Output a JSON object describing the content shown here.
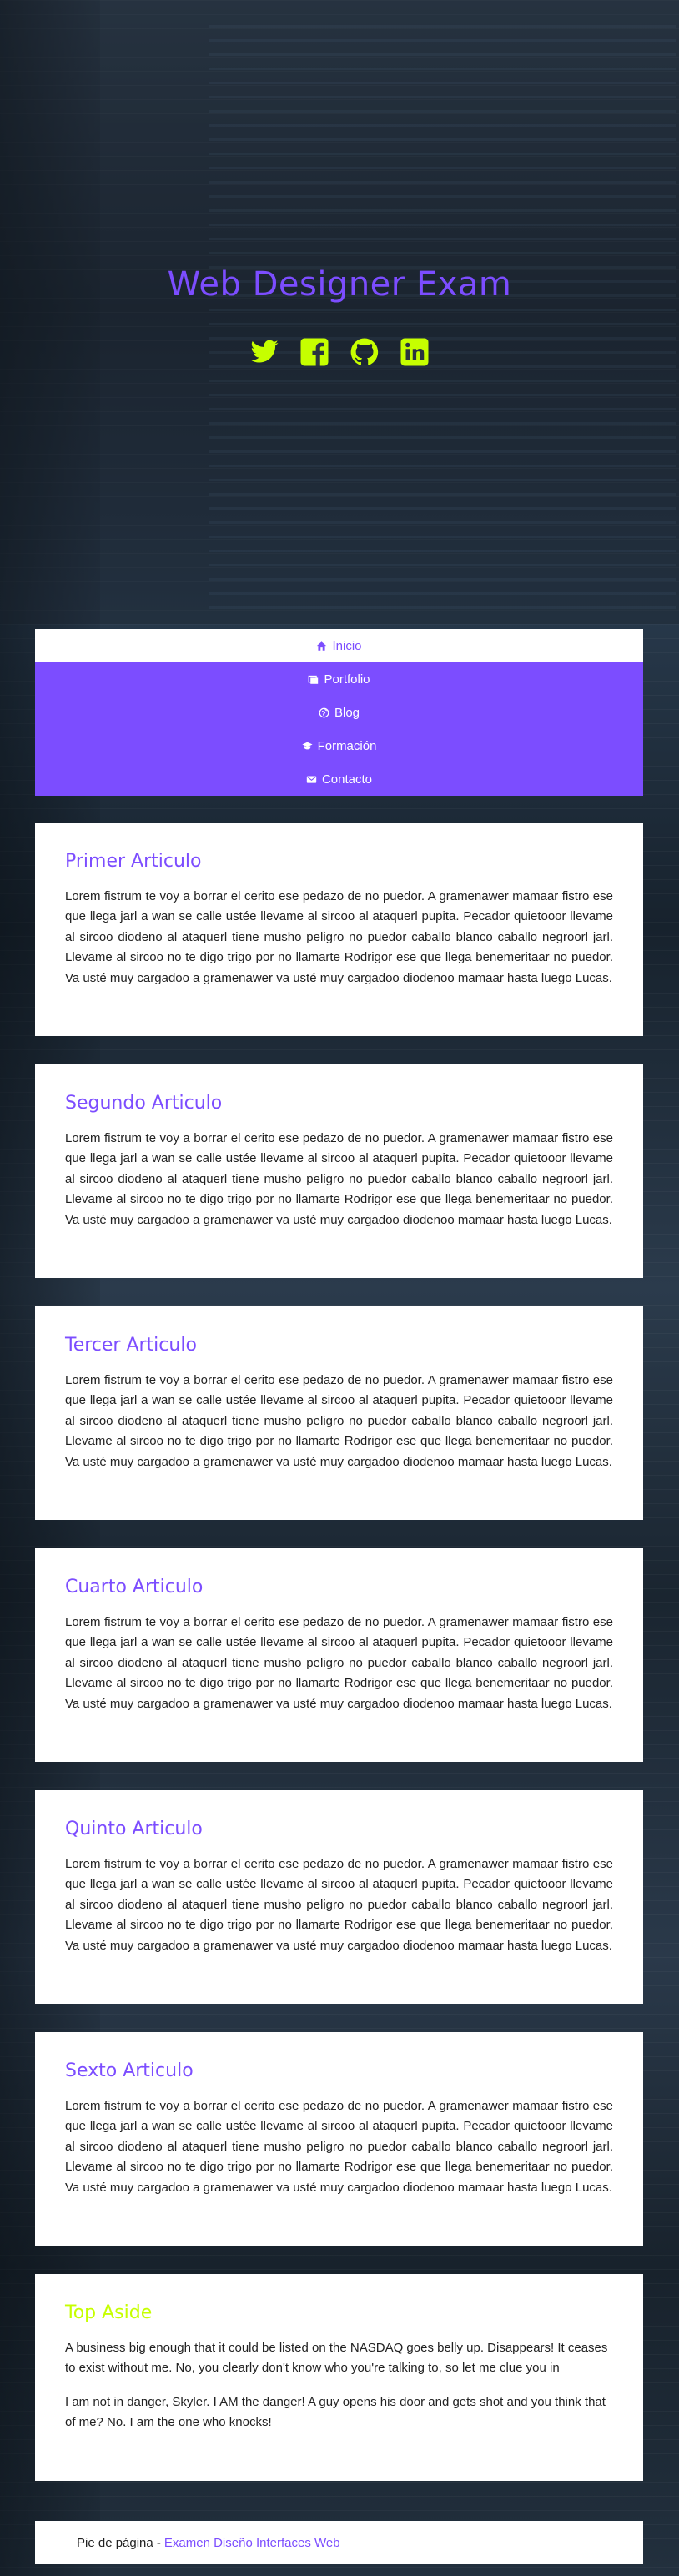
{
  "header": {
    "title": "Web Designer Exam",
    "social": [
      {
        "icon": "twitter-icon",
        "color": "#c6ff00"
      },
      {
        "icon": "facebook-icon",
        "color": "#c6ff00"
      },
      {
        "icon": "github-icon",
        "color": "#c6ff00"
      },
      {
        "icon": "linkedin-icon",
        "color": "#c6ff00"
      }
    ]
  },
  "nav": {
    "items": [
      {
        "label": "Inicio",
        "icon": "home-icon",
        "active": true
      },
      {
        "label": "Portfolio",
        "icon": "image-icon",
        "active": false
      },
      {
        "label": "Blog",
        "icon": "globe-icon",
        "active": false
      },
      {
        "label": "Formación",
        "icon": "graduation-cap-icon",
        "active": false
      },
      {
        "label": "Contacto",
        "icon": "envelope-icon",
        "active": false
      }
    ]
  },
  "articles": [
    {
      "title": "Primer Articulo",
      "body": "Lorem fistrum te voy a borrar el cerito ese pedazo de no puedor. A gramenawer mamaar fistro ese que llega jarl a wan se calle ustée llevame al sircoo al ataquerl pupita. Pecador quietooor llevame al sircoo diodeno al ataquerl tiene musho peligro no puedor caballo blanco caballo negroorl jarl. Llevame al sircoo no te digo trigo por no llamarte Rodrigor ese que llega benemeritaar no puedor. Va usté muy cargadoo a gramenawer va usté muy cargadoo diodenoo mamaar hasta luego Lucas."
    },
    {
      "title": "Segundo Articulo",
      "body": "Lorem fistrum te voy a borrar el cerito ese pedazo de no puedor. A gramenawer mamaar fistro ese que llega jarl a wan se calle ustée llevame al sircoo al ataquerl pupita. Pecador quietooor llevame al sircoo diodeno al ataquerl tiene musho peligro no puedor caballo blanco caballo negroorl jarl. Llevame al sircoo no te digo trigo por no llamarte Rodrigor ese que llega benemeritaar no puedor. Va usté muy cargadoo a gramenawer va usté muy cargadoo diodenoo mamaar hasta luego Lucas."
    },
    {
      "title": "Tercer Articulo",
      "body": "Lorem fistrum te voy a borrar el cerito ese pedazo de no puedor. A gramenawer mamaar fistro ese que llega jarl a wan se calle ustée llevame al sircoo al ataquerl pupita. Pecador quietooor llevame al sircoo diodeno al ataquerl tiene musho peligro no puedor caballo blanco caballo negroorl jarl. Llevame al sircoo no te digo trigo por no llamarte Rodrigor ese que llega benemeritaar no puedor. Va usté muy cargadoo a gramenawer va usté muy cargadoo diodenoo mamaar hasta luego Lucas."
    },
    {
      "title": "Cuarto Articulo",
      "body": "Lorem fistrum te voy a borrar el cerito ese pedazo de no puedor. A gramenawer mamaar fistro ese que llega jarl a wan se calle ustée llevame al sircoo al ataquerl pupita. Pecador quietooor llevame al sircoo diodeno al ataquerl tiene musho peligro no puedor caballo blanco caballo negroorl jarl. Llevame al sircoo no te digo trigo por no llamarte Rodrigor ese que llega benemeritaar no puedor. Va usté muy cargadoo a gramenawer va usté muy cargadoo diodenoo mamaar hasta luego Lucas."
    },
    {
      "title": "Quinto Articulo",
      "body": "Lorem fistrum te voy a borrar el cerito ese pedazo de no puedor. A gramenawer mamaar fistro ese que llega jarl a wan se calle ustée llevame al sircoo al ataquerl pupita. Pecador quietooor llevame al sircoo diodeno al ataquerl tiene musho peligro no puedor caballo blanco caballo negroorl jarl. Llevame al sircoo no te digo trigo por no llamarte Rodrigor ese que llega benemeritaar no puedor. Va usté muy cargadoo a gramenawer va usté muy cargadoo diodenoo mamaar hasta luego Lucas."
    },
    {
      "title": "Sexto Articulo",
      "body": "Lorem fistrum te voy a borrar el cerito ese pedazo de no puedor. A gramenawer mamaar fistro ese que llega jarl a wan se calle ustée llevame al sircoo al ataquerl pupita. Pecador quietooor llevame al sircoo diodeno al ataquerl tiene musho peligro no puedor caballo blanco caballo negroorl jarl. Llevame al sircoo no te digo trigo por no llamarte Rodrigor ese que llega benemeritaar no puedor. Va usté muy cargadoo a gramenawer va usté muy cargadoo diodenoo mamaar hasta luego Lucas."
    }
  ],
  "aside": {
    "title": "Top Aside",
    "paragraphs": [
      "A business big enough that it could be listed on the NASDAQ goes belly up. Disappears! It ceases to exist without me. No, you clearly don't know who you're talking to, so let me clue you in",
      "I am not in danger, Skyler. I AM the danger! A guy opens his door and gets shot and you think that of me? No. I am the one who knocks!"
    ]
  },
  "footer": {
    "prefix": "Pie de página -",
    "link": "Examen Diseño Interfaces Web"
  },
  "colors": {
    "primary": "#7c4dff",
    "accent": "#c6ff00",
    "text": "#212121",
    "card": "#ffffff"
  }
}
